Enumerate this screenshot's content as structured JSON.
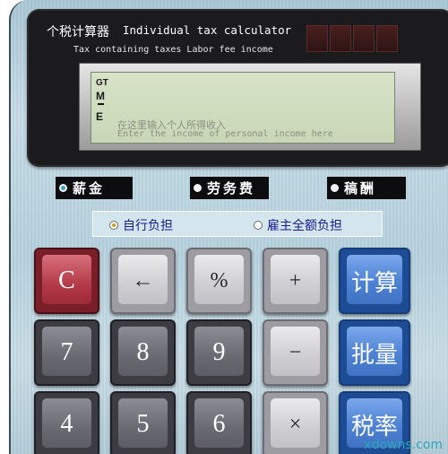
{
  "header": {
    "title_cn": "个税计算器",
    "title_en": "Individual tax calculator",
    "subtitle": "Tax containing taxes  Labor fee income"
  },
  "display": {
    "indicators": {
      "gt": "GT",
      "m": "M",
      "e": "E"
    },
    "hint_cn": "在这里输入个人所得收入",
    "hint_en": "Enter the income of personal income here"
  },
  "modes": {
    "selected": "salary",
    "items": [
      {
        "id": "salary",
        "label": "薪金"
      },
      {
        "id": "labor",
        "label": "劳务费"
      },
      {
        "id": "royalty",
        "label": "稿酬"
      }
    ]
  },
  "burden": {
    "selected": "self",
    "options": [
      {
        "id": "self",
        "label": "自行负担"
      },
      {
        "id": "employer",
        "label": "雇主全额负担"
      }
    ]
  },
  "keys": {
    "clear": "C",
    "backspace": "←",
    "percent": "%",
    "plus": "+",
    "minus": "−",
    "times": "×",
    "d7": "7",
    "d8": "8",
    "d9": "9",
    "d4": "4",
    "d5": "5",
    "d6": "6",
    "calculate": "计算",
    "batch": "批量",
    "tax_rate": "税率"
  },
  "watermark": "xdowns.com",
  "colors": {
    "accent_blue": "#4e82d4",
    "clear_red": "#b43a48",
    "lcd": "#d8e3c8",
    "body": "#b6d2de"
  }
}
